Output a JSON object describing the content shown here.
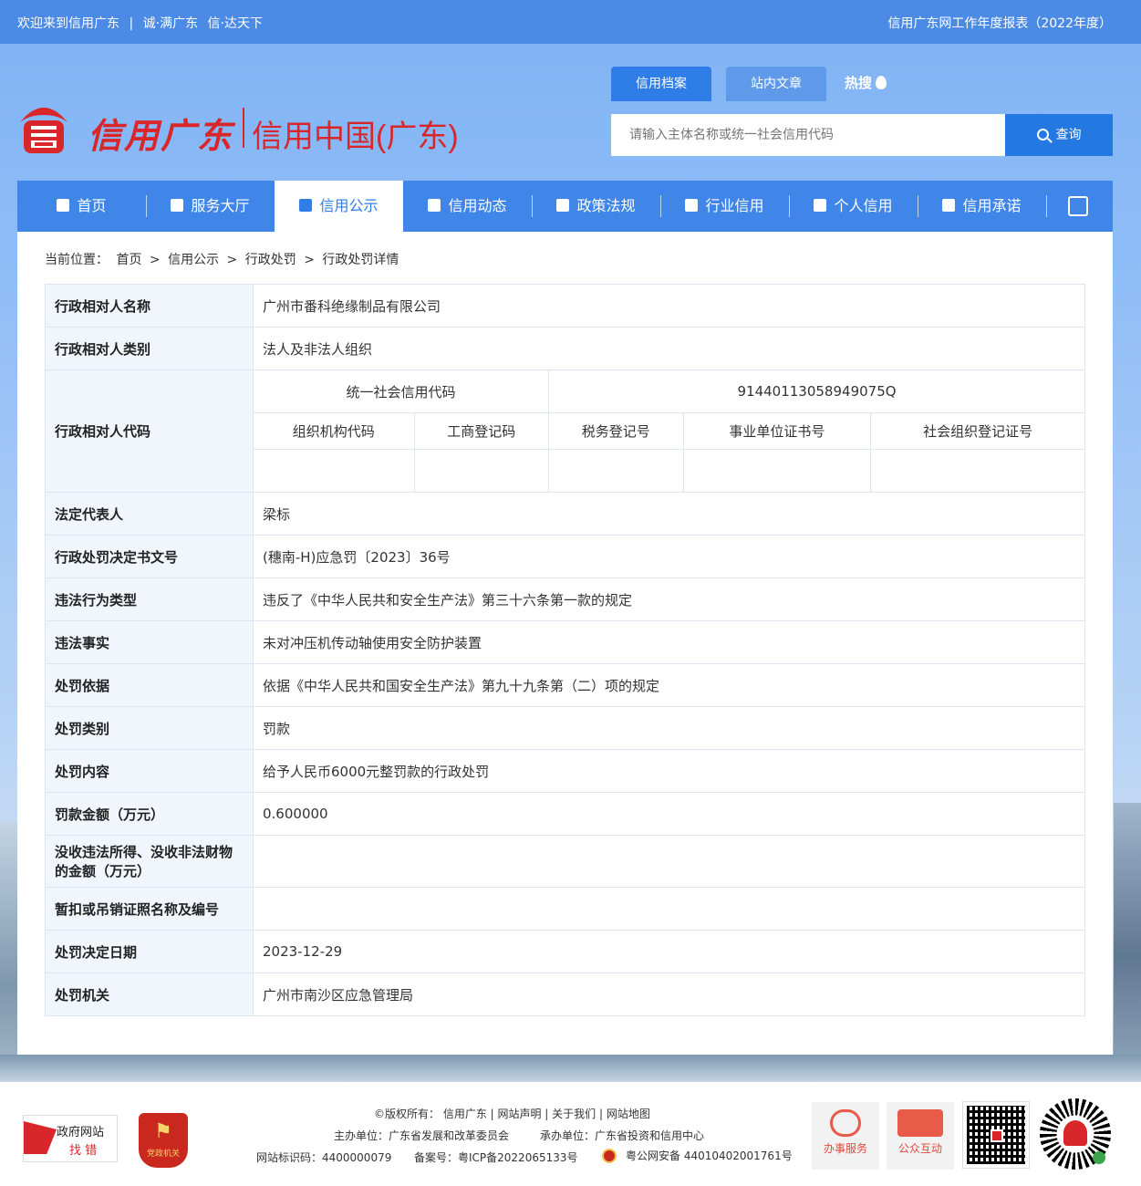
{
  "topbar": {
    "welcome": "欢迎来到信用广东",
    "sep1": "|",
    "slogan1": "诚·满广东",
    "slogan2": "信·达天下",
    "annual_report": "信用广东网工作年度报表（2022年度）"
  },
  "logo": {
    "name_cn": "信用广东",
    "name_cn2": "信用中国(广东)"
  },
  "search": {
    "tab_active": "信用档案",
    "tab_other": "站内文章",
    "hot": "热搜",
    "placeholder": "请输入主体名称或统一社会信用代码",
    "button": "查询"
  },
  "nav": {
    "items": [
      {
        "label": "首页"
      },
      {
        "label": "服务大厅"
      },
      {
        "label": "信用公示"
      },
      {
        "label": "信用动态"
      },
      {
        "label": "政策法规"
      },
      {
        "label": "行业信用"
      },
      {
        "label": "个人信用"
      },
      {
        "label": "信用承诺"
      }
    ]
  },
  "breadcrumb": {
    "prefix": "当前位置：",
    "items": [
      "首页",
      "信用公示",
      "行政处罚",
      "行政处罚详情"
    ],
    "sep": ">"
  },
  "detail": {
    "rows": [
      {
        "label": "行政相对人名称",
        "value": "广州市番科绝缘制品有限公司"
      },
      {
        "label": "行政相对人类别",
        "value": "法人及非法人组织"
      }
    ],
    "code_label": "行政相对人代码",
    "code_uscc_label": "统一社会信用代码",
    "code_uscc_value": "91440113058949075Q",
    "code_sub_labels": [
      "组织机构代码",
      "工商登记码",
      "税务登记号",
      "事业单位证书号",
      "社会组织登记证号"
    ],
    "rows2": [
      {
        "label": "法定代表人",
        "value": "梁标"
      },
      {
        "label": "行政处罚决定书文号",
        "value": "(穗南-H)应急罚〔2023〕36号"
      },
      {
        "label": "违法行为类型",
        "value": "违反了《中华人民共和安全生产法》第三十六条第一款的规定"
      },
      {
        "label": "违法事实",
        "value": "未对冲压机传动轴使用安全防护装置"
      },
      {
        "label": "处罚依据",
        "value": "依据《中华人民共和国安全生产法》第九十九条第（二）项的规定"
      },
      {
        "label": "处罚类别",
        "value": "罚款"
      },
      {
        "label": "处罚内容",
        "value": "给予人民币6000元整罚款的行政处罚"
      },
      {
        "label": "罚款金额（万元）",
        "value": "0.600000"
      },
      {
        "label": "没收违法所得、没收非法财物的金额（万元）",
        "value": ""
      },
      {
        "label": "暂扣或吊销证照名称及编号",
        "value": ""
      },
      {
        "label": "处罚决定日期",
        "value": "2023-12-29"
      },
      {
        "label": "处罚机关",
        "value": "广州市南沙区应急管理局"
      }
    ]
  },
  "footer": {
    "zhaocuo_1": "政府网站",
    "zhaocuo_2": "找 错",
    "dangzheng": "党政机关",
    "line1": "©版权所有： 信用广东  |  网站声明  |  关于我们  |  网站地图",
    "host": "主办单位：广东省发展和改革委员会",
    "undertake": "承办单位：广东省投资和信用中心",
    "site_id": "网站标识码：4400000079",
    "icp": "备案号：粤ICP备2022065133号",
    "police": "粤公网安备 44010402001761号",
    "btn_service": "办事服务",
    "btn_interact": "公众互动"
  },
  "colors": {
    "topbar": "#4b8be6",
    "nav": "#3f86e8",
    "accent": "#2f7de6",
    "brand_red": "#d8262a"
  }
}
